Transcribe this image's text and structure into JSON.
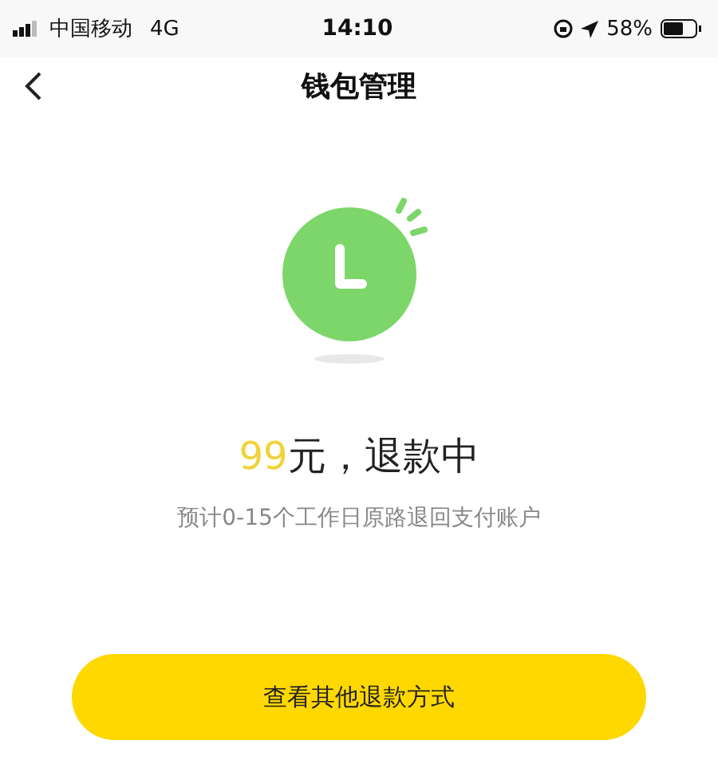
{
  "status_bar": {
    "carrier": "中国移动",
    "network": "4G",
    "time": "14:10",
    "battery": "58%"
  },
  "nav": {
    "title": "钱包管理"
  },
  "refund": {
    "amount": "99",
    "status": "元，退款中",
    "note": "预计0-15个工作日原路退回支付账户"
  },
  "button": {
    "label": "查看其他退款方式"
  }
}
